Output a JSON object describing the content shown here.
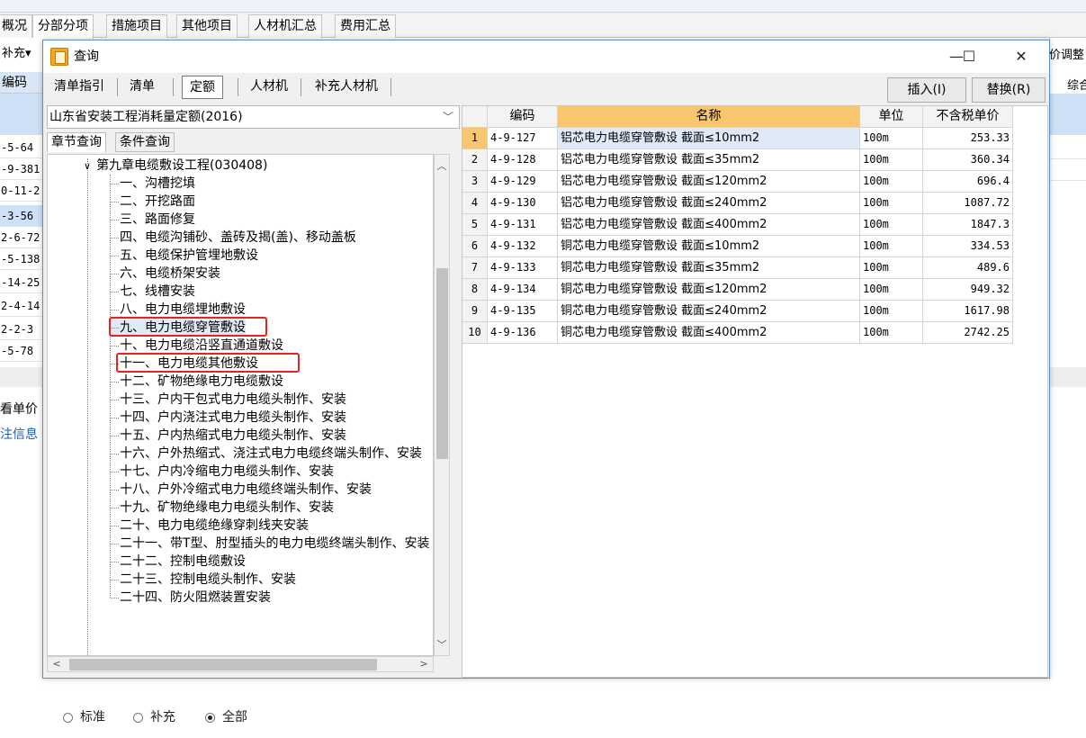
{
  "app": {
    "tabs": [
      "概况",
      "分部分项",
      "措施项目",
      "其他项目",
      "人材机汇总",
      "费用汇总"
    ],
    "active_tab": 1,
    "left_button": "补充",
    "left_col_header": "编码",
    "left_codes": [
      "-5-64",
      "-9-381",
      "0-11-2",
      "-3-56",
      "2-6-72",
      "-5-138",
      "-14-25",
      "2-4-14",
      "2-2-3",
      "-5-78"
    ],
    "left_labels": [
      "看单价",
      "注信息"
    ],
    "right_header_1": "价调整",
    "right_header_2": "综合"
  },
  "dialog": {
    "title": "查询",
    "win_min": "—",
    "win_max": "☐",
    "win_close": "✕",
    "tabs": [
      "清单指引",
      "清单",
      "定额",
      "人材机",
      "补充人材机"
    ],
    "active_tab": 2,
    "insert_label": "插入(I)",
    "replace_label": "替换(R)",
    "library": "山东省安装工程消耗量定额(2016)",
    "sub_tabs": [
      "章节查询",
      "条件查询"
    ],
    "tree": {
      "chapter": "第九章电缆敷设工程(030408)",
      "items": [
        "一、沟槽挖填",
        "二、开挖路面",
        "三、路面修复",
        "四、电缆沟铺砂、盖砖及揭(盖)、移动盖板",
        "五、电缆保护管埋地敷设",
        "六、电缆桥架安装",
        "七、线槽安装",
        "八、电力电缆埋地敷设",
        "九、电力电缆穿管敷设",
        "十、电力电缆沿竖直通道敷设",
        "十一、电力电缆其他敷设",
        "十二、矿物绝缘电力电缆敷设",
        "十三、户内干包式电力电缆头制作、安装",
        "十四、户内浇注式电力电缆头制作、安装",
        "十五、户内热缩式电力电缆头制作、安装",
        "十六、户外热缩式、浇注式电力电缆终端头制作、安装",
        "十七、户内冷缩电力电缆头制作、安装",
        "十八、户外冷缩式电力电缆终端头制作、安装",
        "十九、矿物绝缘电力电缆头制作、安装",
        "二十、电力电缆绝缘穿刺线夹安装",
        "二十一、带T型、肘型插头的电力电缆终端头制作、安装",
        "二十二、控制电缆敷设",
        "二十三、控制电缆头制作、安装",
        "二十四、防火阻燃装置安装"
      ],
      "selected_index": 8
    },
    "radios": [
      "标准",
      "补充",
      "全部"
    ],
    "radio_selected": 2,
    "grid": {
      "headers": [
        "",
        "编码",
        "名称",
        "单位",
        "不含税单价"
      ],
      "rows": [
        {
          "idx": "1",
          "code": "4-9-127",
          "name": "铝芯电力电缆穿管敷设 截面≤10mm2",
          "unit": "100m",
          "price": "253.33"
        },
        {
          "idx": "2",
          "code": "4-9-128",
          "name": "铝芯电力电缆穿管敷设 截面≤35mm2",
          "unit": "100m",
          "price": "360.34"
        },
        {
          "idx": "3",
          "code": "4-9-129",
          "name": "铝芯电力电缆穿管敷设 截面≤120mm2",
          "unit": "100m",
          "price": "696.4"
        },
        {
          "idx": "4",
          "code": "4-9-130",
          "name": "铝芯电力电缆穿管敷设 截面≤240mm2",
          "unit": "100m",
          "price": "1087.72"
        },
        {
          "idx": "5",
          "code": "4-9-131",
          "name": "铝芯电力电缆穿管敷设 截面≤400mm2",
          "unit": "100m",
          "price": "1847.3"
        },
        {
          "idx": "6",
          "code": "4-9-132",
          "name": "铜芯电力电缆穿管敷设 截面≤10mm2",
          "unit": "100m",
          "price": "334.53"
        },
        {
          "idx": "7",
          "code": "4-9-133",
          "name": "铜芯电力电缆穿管敷设 截面≤35mm2",
          "unit": "100m",
          "price": "489.6"
        },
        {
          "idx": "8",
          "code": "4-9-134",
          "name": "铜芯电力电缆穿管敷设 截面≤120mm2",
          "unit": "100m",
          "price": "949.32"
        },
        {
          "idx": "9",
          "code": "4-9-135",
          "name": "铜芯电力电缆穿管敷设 截面≤240mm2",
          "unit": "100m",
          "price": "1617.98"
        },
        {
          "idx": "10",
          "code": "4-9-136",
          "name": "铜芯电力电缆穿管敷设 截面≤400mm2",
          "unit": "100m",
          "price": "2742.25"
        }
      ],
      "selected_index": 0
    }
  },
  "colors": {
    "highlight_orange": "#f7c66f",
    "selection_blue": "#dfe9f7",
    "annotation_red": "#e3261b",
    "dialog_border": "#5d8fc9"
  }
}
